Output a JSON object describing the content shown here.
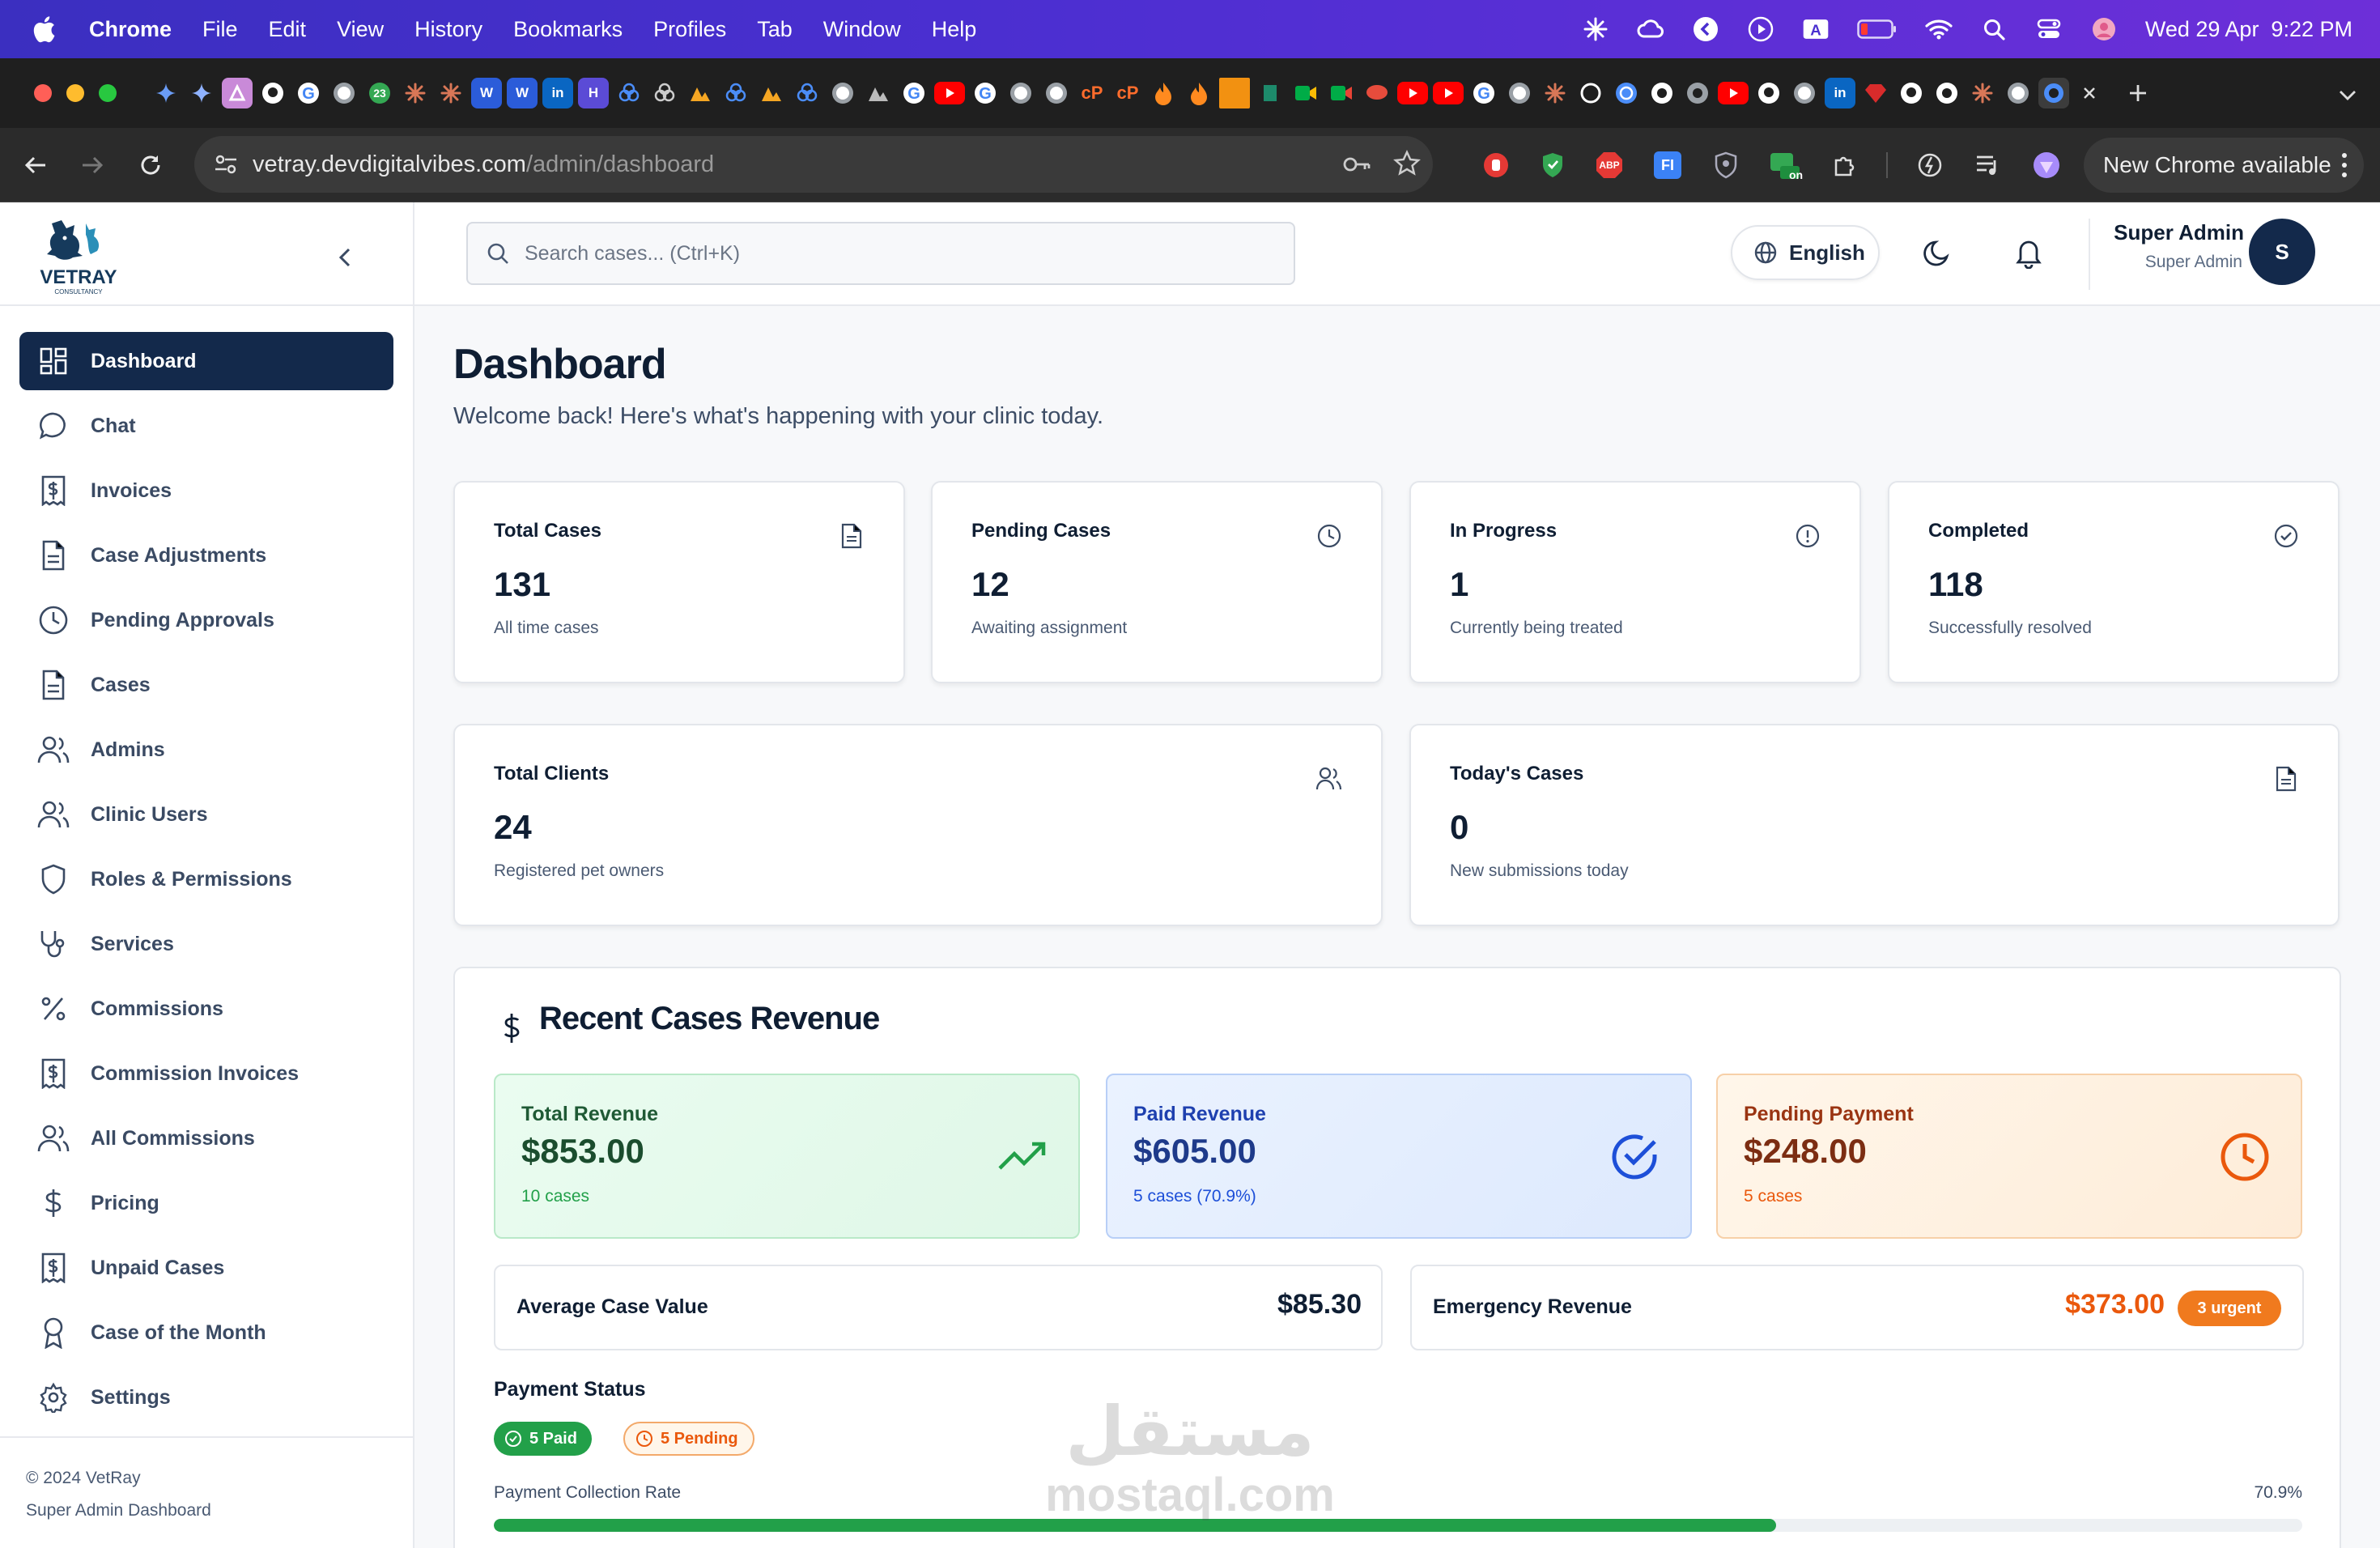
{
  "menubar": {
    "app": "Chrome",
    "items": [
      "File",
      "Edit",
      "View",
      "History",
      "Bookmarks",
      "Profiles",
      "Tab",
      "Window",
      "Help"
    ],
    "clock": "Wed 29 Apr  9:22 PM"
  },
  "browser": {
    "url_host": "vetray.devdigitalvibes.com",
    "url_path": "/admin/dashboard",
    "new_chrome": "New Chrome available",
    "tab_badge": "23",
    "ext_badge": "on",
    "abp": "ABP",
    "fi": "FI"
  },
  "sidebar": {
    "brand": "VETRAY",
    "brand_sub": "CONSULTANCY",
    "items": [
      {
        "label": "Dashboard",
        "icon": "dashboard-icon"
      },
      {
        "label": "Chat",
        "icon": "chat-icon"
      },
      {
        "label": "Invoices",
        "icon": "invoice-icon"
      },
      {
        "label": "Case Adjustments",
        "icon": "document-icon"
      },
      {
        "label": "Pending Approvals",
        "icon": "clock-icon"
      },
      {
        "label": "Cases",
        "icon": "document-icon"
      },
      {
        "label": "Admins",
        "icon": "users-icon"
      },
      {
        "label": "Clinic Users",
        "icon": "users-icon"
      },
      {
        "label": "Roles & Permissions",
        "icon": "shield-icon"
      },
      {
        "label": "Services",
        "icon": "stethoscope-icon"
      },
      {
        "label": "Commissions",
        "icon": "percent-icon"
      },
      {
        "label": "Commission Invoices",
        "icon": "invoice-icon"
      },
      {
        "label": "All Commissions",
        "icon": "users-icon"
      },
      {
        "label": "Pricing",
        "icon": "dollar-icon"
      },
      {
        "label": "Unpaid Cases",
        "icon": "invoice-icon"
      },
      {
        "label": "Case of the Month",
        "icon": "award-icon"
      },
      {
        "label": "Settings",
        "icon": "gear-icon"
      }
    ],
    "footer_copy": "© 2024 VetRay",
    "footer_sub": "Super Admin Dashboard"
  },
  "header": {
    "search_placeholder": "Search cases... (Ctrl+K)",
    "language": "English",
    "user_name": "Super Admin",
    "user_role": "Super Admin",
    "avatar_initial": "S"
  },
  "page": {
    "title": "Dashboard",
    "subtitle": "Welcome back! Here's what's happening with your clinic today."
  },
  "stats": [
    {
      "label": "Total Cases",
      "value": "131",
      "sub": "All time cases",
      "icon": "document-icon"
    },
    {
      "label": "Pending Cases",
      "value": "12",
      "sub": "Awaiting assignment",
      "icon": "clock-icon"
    },
    {
      "label": "In Progress",
      "value": "1",
      "sub": "Currently being treated",
      "icon": "alert-icon"
    },
    {
      "label": "Completed",
      "value": "118",
      "sub": "Successfully resolved",
      "icon": "check-circle-icon"
    },
    {
      "label": "Total Clients",
      "value": "24",
      "sub": "Registered pet owners",
      "icon": "users-icon"
    },
    {
      "label": "Today's Cases",
      "value": "0",
      "sub": "New submissions today",
      "icon": "document-icon"
    }
  ],
  "revenue": {
    "title": "Recent Cases Revenue",
    "cards": [
      {
        "label": "Total Revenue",
        "value": "$853.00",
        "sub": "10 cases",
        "icon": "trending-up-icon",
        "color": "#22a049"
      },
      {
        "label": "Paid Revenue",
        "value": "$605.00",
        "sub": "5 cases (70.9%)",
        "icon": "check-circle-icon",
        "color": "#1d4fd8"
      },
      {
        "label": "Pending Payment",
        "value": "$248.00",
        "sub": "5 cases",
        "icon": "clock-icon",
        "color": "#ea580c"
      }
    ],
    "avg_label": "Average Case Value",
    "avg_value": "$85.30",
    "emergency_label": "Emergency Revenue",
    "emergency_value": "$373.00",
    "urgent_badge": "3 urgent",
    "payment_status_label": "Payment Status",
    "paid_pill": "5 Paid",
    "pending_pill": "5 Pending",
    "collection_label": "Payment Collection Rate",
    "collection_pct": "70.9%",
    "collection_rate": 0.709
  },
  "watermark": {
    "arabic": "مستقل",
    "latin": "mostaql.com"
  }
}
